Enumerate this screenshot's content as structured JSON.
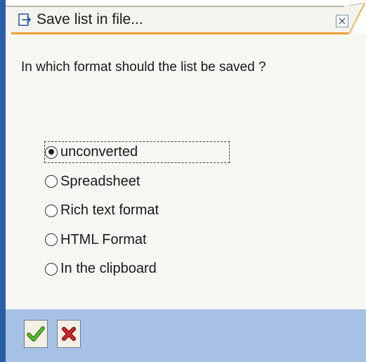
{
  "dialog": {
    "title": "Save list in file...",
    "question": "In which format should the list be saved ?",
    "options": [
      {
        "label": "unconverted",
        "checked": true
      },
      {
        "label": "Spreadsheet",
        "checked": false
      },
      {
        "label": "Rich text format",
        "checked": false
      },
      {
        "label": "HTML Format",
        "checked": false
      },
      {
        "label": "In the clipboard",
        "checked": false
      }
    ]
  },
  "colors": {
    "accent_stripe": "#2a5ea8",
    "title_underline": "#e8a33a",
    "toolbar_bg": "#a7c0e6",
    "ok_check": "#3a9a1e",
    "cancel_x": "#c8202a"
  },
  "icons": {
    "title": "save-list-icon",
    "close": "close-icon",
    "ok": "checkmark-icon",
    "cancel": "cancel-x-icon"
  }
}
